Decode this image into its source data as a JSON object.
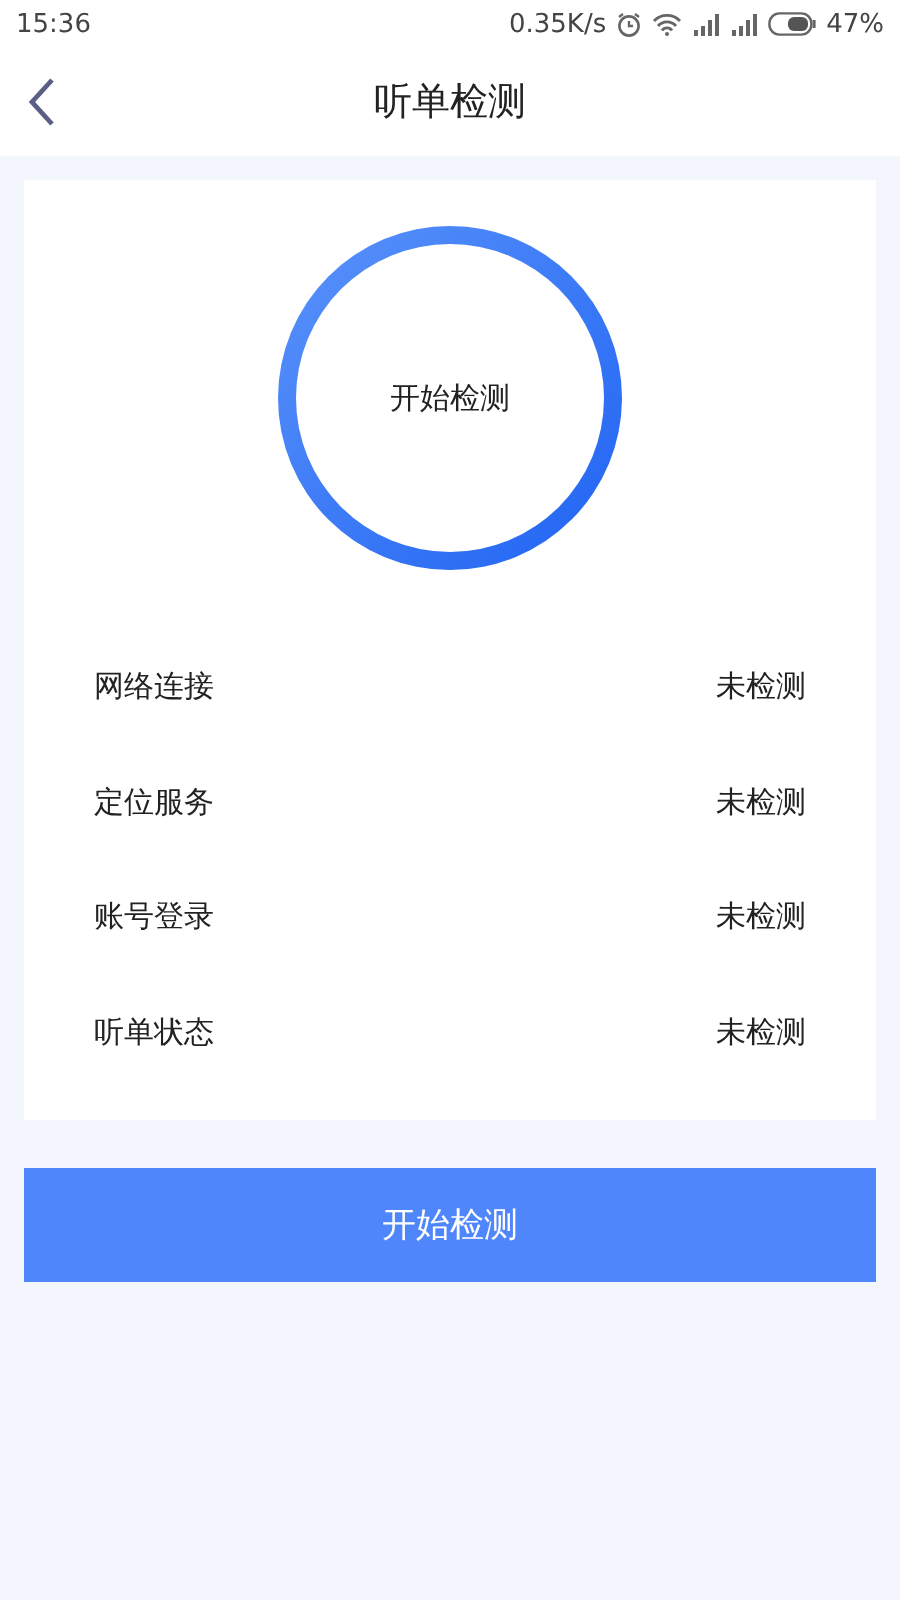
{
  "status_bar": {
    "time": "15:36",
    "speed": "0.35K/s",
    "battery": "47%"
  },
  "header": {
    "title": "听单检测"
  },
  "check_circle": {
    "label": "开始检测"
  },
  "items": [
    {
      "name": "网络连接",
      "status": "未检测"
    },
    {
      "name": "定位服务",
      "status": "未检测"
    },
    {
      "name": "账号登录",
      "status": "未检测"
    },
    {
      "name": "听单状态",
      "status": "未检测"
    }
  ],
  "start_button": {
    "label": "开始检测"
  }
}
